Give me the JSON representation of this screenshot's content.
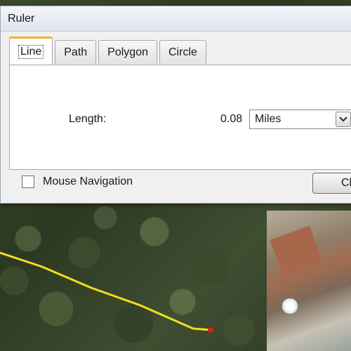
{
  "window": {
    "title": "Ruler"
  },
  "tabs": [
    {
      "label": "Line",
      "active": true
    },
    {
      "label": "Path",
      "active": false
    },
    {
      "label": "Polygon",
      "active": false
    },
    {
      "label": "Circle",
      "active": false
    }
  ],
  "measurement": {
    "length_label": "Length:",
    "length_value": "0.08",
    "units_selected": "Miles"
  },
  "footer": {
    "mouse_navigation_label": "Mouse Navigation",
    "mouse_navigation_checked": false,
    "close_label": "Cl"
  },
  "colors": {
    "active_tab_accent": "#f0b030",
    "ruler_line": "#f0e020",
    "endpoint": "#e02010"
  },
  "icons": {
    "units_dropdown": "chevron-down-icon",
    "endpoint": "endpoint-marker-icon"
  }
}
